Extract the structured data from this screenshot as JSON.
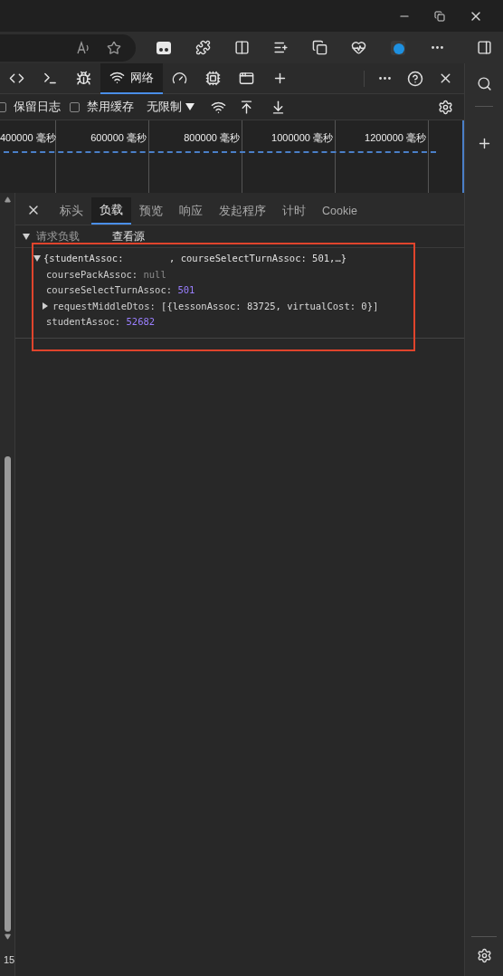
{
  "devtools": {
    "tabs": [
      {
        "kind": "elements",
        "selected": false
      },
      {
        "kind": "console",
        "selected": false
      },
      {
        "kind": "sources",
        "selected": false
      },
      {
        "kind": "network",
        "label": "网络",
        "selected": true
      },
      {
        "kind": "performance",
        "selected": false
      },
      {
        "kind": "memory",
        "selected": false
      },
      {
        "kind": "application",
        "selected": false
      },
      {
        "kind": "add",
        "selected": false
      }
    ],
    "toolbar": {
      "preserve_log": {
        "label": "保留日志",
        "checked": false
      },
      "disable_cache": {
        "label": "禁用缓存",
        "checked": false
      },
      "throttling": "无限制"
    },
    "timeline": {
      "ticks": [
        "400000 毫秒",
        "600000 毫秒",
        "800000 毫秒",
        "1000000 毫秒",
        "1200000 毫秒"
      ]
    },
    "detail_tabs": [
      {
        "label": "标头",
        "selected": false
      },
      {
        "label": "负载",
        "selected": true
      },
      {
        "label": "预览",
        "selected": false
      },
      {
        "label": "响应",
        "selected": false
      },
      {
        "label": "发起程序",
        "selected": false
      },
      {
        "label": "计时",
        "selected": false
      },
      {
        "label": "Cookie",
        "selected": false
      }
    ],
    "payload": {
      "section_title": "请求负载",
      "expanded": true,
      "view_source": "查看源",
      "summary": {
        "expanded": true,
        "prefix": "{studentAssoc:",
        "suffix": ", courseSelectTurnAssoc: 501,…}"
      },
      "properties": [
        {
          "key": "coursePackAssoc:",
          "value": "null",
          "kind": "null",
          "expandable": false
        },
        {
          "key": "courseSelectTurnAssoc:",
          "value": "501",
          "kind": "number",
          "expandable": false
        },
        {
          "key": "requestMiddleDtos:",
          "value": "[{lessonAssoc: 83725, virtualCost: 0}]",
          "kind": "array",
          "expandable": true
        },
        {
          "key": "studentAssoc:",
          "value": "52682",
          "kind": "number",
          "expandable": false
        }
      ]
    },
    "footer_count": "15"
  }
}
